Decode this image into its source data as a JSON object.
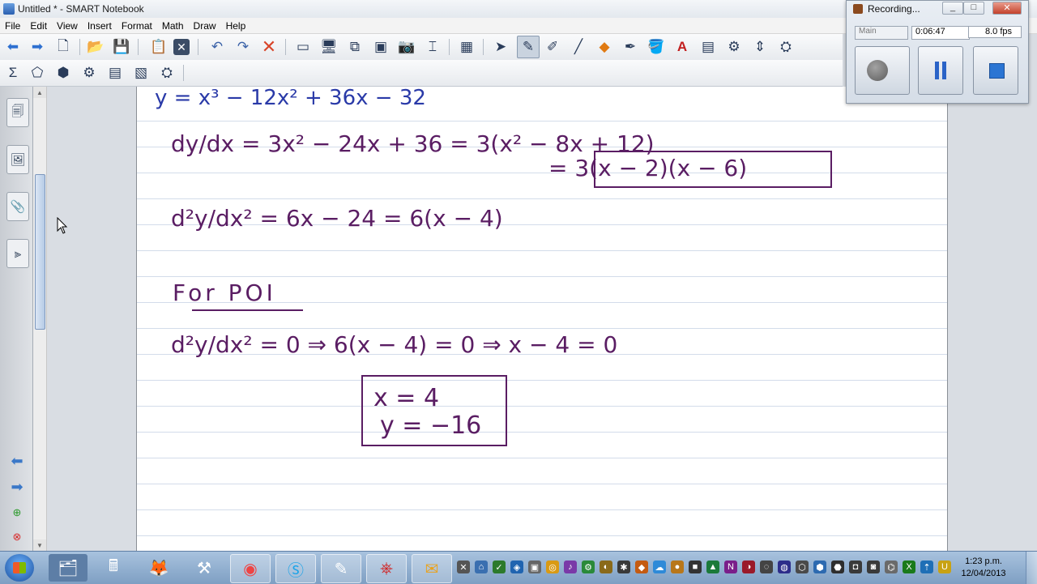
{
  "window": {
    "title": "Untitled * - SMART Notebook"
  },
  "menu": [
    "File",
    "Edit",
    "View",
    "Insert",
    "Format",
    "Math",
    "Draw",
    "Help"
  ],
  "toolbar1_icons": [
    "back-arrow",
    "forward-arrow",
    "new-page",
    "open-folder",
    "save",
    "paste",
    "delete-page",
    "undo",
    "redo",
    "delete",
    "screen-shade",
    "full-screen",
    "transparent-bg",
    "dual-page",
    "capture",
    "document-camera",
    "table",
    "select",
    "pen",
    "creative-pen",
    "eraser",
    "line",
    "shapes",
    "magic-pen",
    "fill",
    "text",
    "properties",
    "measurement",
    "move-toolbar",
    "settings"
  ],
  "toolbar2_icons": [
    "sigma",
    "geometry",
    "shapes-3d",
    "measure",
    "table-tools",
    "graph",
    "settings-addons"
  ],
  "notebook": {
    "lines": [
      "y = x³ − 12x² + 36x − 32",
      "dy/dx = 3x² − 24x + 36 = 3(x² − 8x + 12)",
      "= 3(x − 2)(x − 6)",
      "d²y/dx² = 6x − 24 = 6(x − 4)",
      "For POI",
      "d²y/dx² = 0 ⇒ 6(x − 4) = 0 ⇒ x − 4 = 0",
      "x = 4",
      "y = −16"
    ]
  },
  "recorder": {
    "title": "Recording...",
    "source": "Main",
    "elapsed": "0:06:47",
    "fps": "8.0 fps",
    "buttons": [
      "record",
      "pause",
      "stop"
    ]
  },
  "taskbar": {
    "apps": [
      "explorer",
      "calculator",
      "firefox",
      "tools",
      "chrome",
      "skype",
      "smart-notebook",
      "acrobat",
      "outlook"
    ],
    "clock_time": "1:23 p.m.",
    "clock_date": "12/04/2013"
  },
  "colors": {
    "ink_blue": "#2a3aa8",
    "ink_purple": "#5a1d63",
    "page_rule": "#d3dcea",
    "taskbar": "#8aa9cc"
  }
}
